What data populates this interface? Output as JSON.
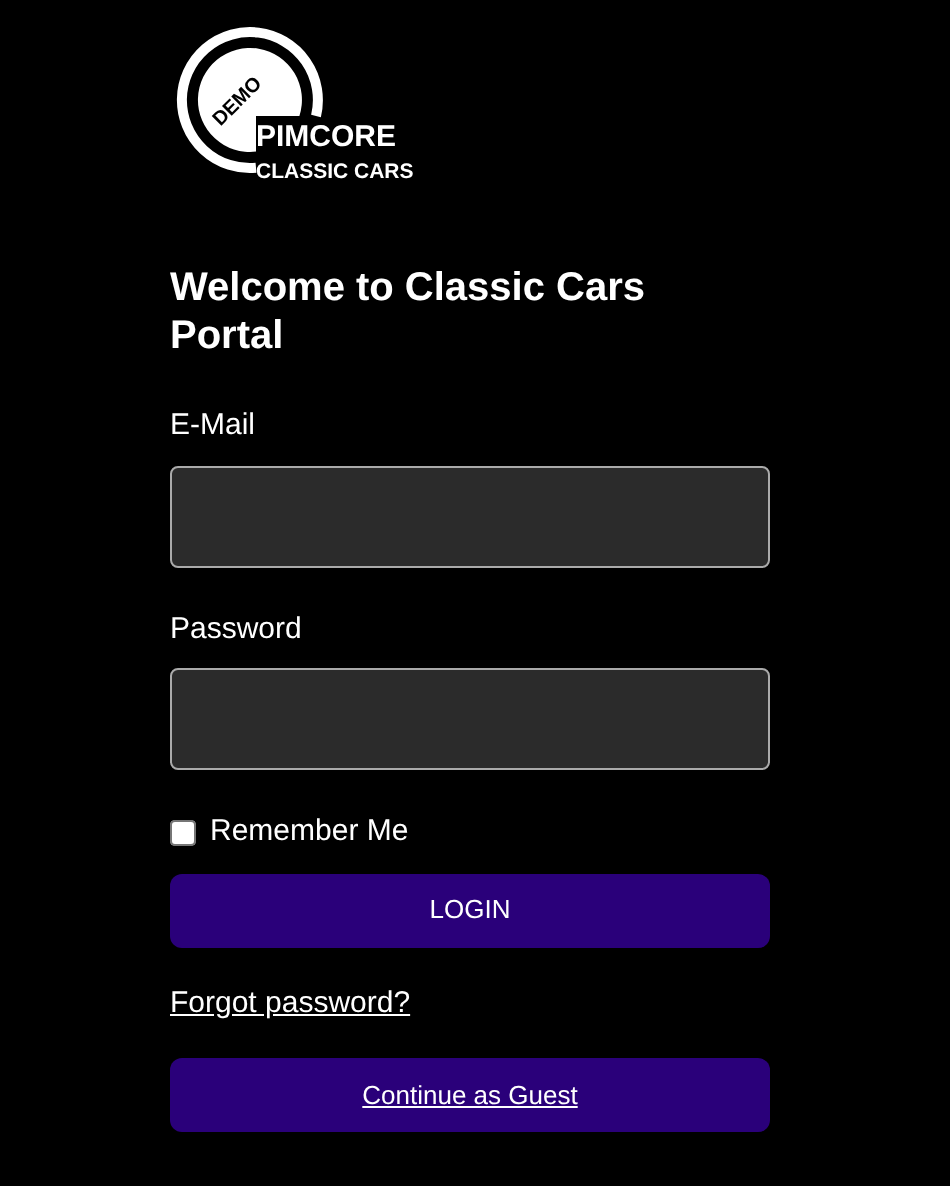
{
  "logo": {
    "badge": "DEMO",
    "brand": "PIMCORE",
    "subtitle": "CLASSIC CARS"
  },
  "heading": "Welcome to Classic Cars Portal",
  "fields": [
    {
      "label": "E-Mail"
    },
    {
      "label": "Password"
    }
  ],
  "remember": {
    "label": "Remember Me",
    "checked": false
  },
  "login_button": "LOGIN",
  "forgot_link": "Forgot password?",
  "guest_button": "Continue as Guest"
}
